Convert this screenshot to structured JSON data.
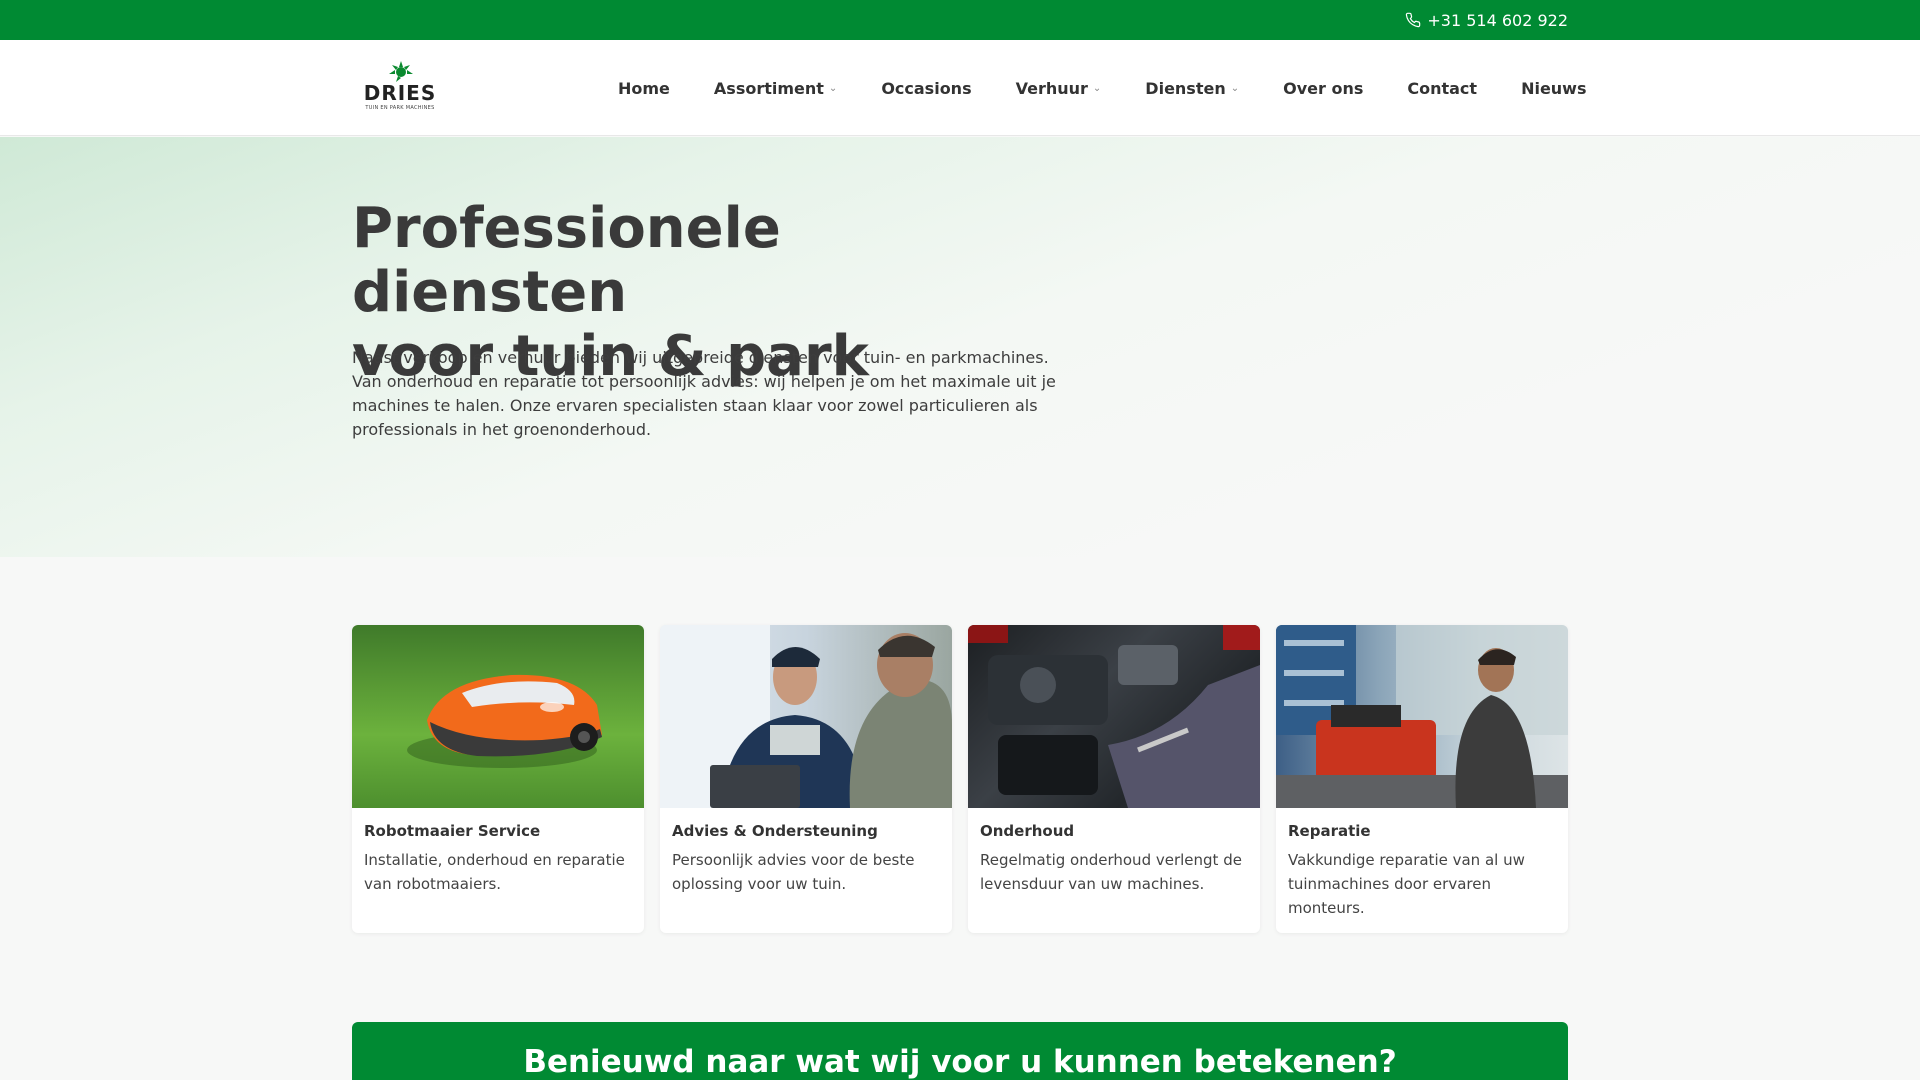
{
  "topbar": {
    "phone": "+31 514 602 922"
  },
  "logo": {
    "name": "DRIES",
    "tagline": "TUIN EN PARK MACHINES"
  },
  "nav": [
    {
      "label": "Home",
      "has_dropdown": false
    },
    {
      "label": "Assortiment",
      "has_dropdown": true
    },
    {
      "label": "Occasions",
      "has_dropdown": false
    },
    {
      "label": "Verhuur",
      "has_dropdown": true
    },
    {
      "label": "Diensten",
      "has_dropdown": true
    },
    {
      "label": "Over ons",
      "has_dropdown": false
    },
    {
      "label": "Contact",
      "has_dropdown": false
    },
    {
      "label": "Nieuws",
      "has_dropdown": false
    }
  ],
  "hero": {
    "title_line1": "Professionele diensten",
    "title_line2": "voor tuin & park",
    "text": "Naast verkoop en verhuur bieden wij uitgebreide diensten voor tuin- en parkmachines. Van onderhoud en reparatie tot persoonlijk advies: wij helpen je om het maximale uit je machines te halen. Onze ervaren specialisten staan klaar voor zowel particulieren als professionals in het groenonderhoud."
  },
  "cards": [
    {
      "title": "Robotmaaier Service",
      "desc": "Installatie, onderhoud en reparatie van robotmaaiers.",
      "image": "robotic-lawnmower-photo"
    },
    {
      "title": "Advies & Ondersteuning",
      "desc": "Persoonlijk advies voor de beste oplossing voor uw tuin.",
      "image": "advice-meeting-photo"
    },
    {
      "title": "Onderhoud",
      "desc": "Regelmatig onderhoud verlengt de levensduur van uw machines.",
      "image": "engine-maintenance-photo"
    },
    {
      "title": "Reparatie",
      "desc": "Vakkundige reparatie van al uw tuinmachines door ervaren monteurs.",
      "image": "workshop-repair-photo"
    }
  ],
  "cta": {
    "title": "Benieuwd naar wat wij voor u kunnen betekenen?"
  },
  "colors": {
    "brand_green": "#008a33",
    "text_dark": "#3a3a3a"
  }
}
